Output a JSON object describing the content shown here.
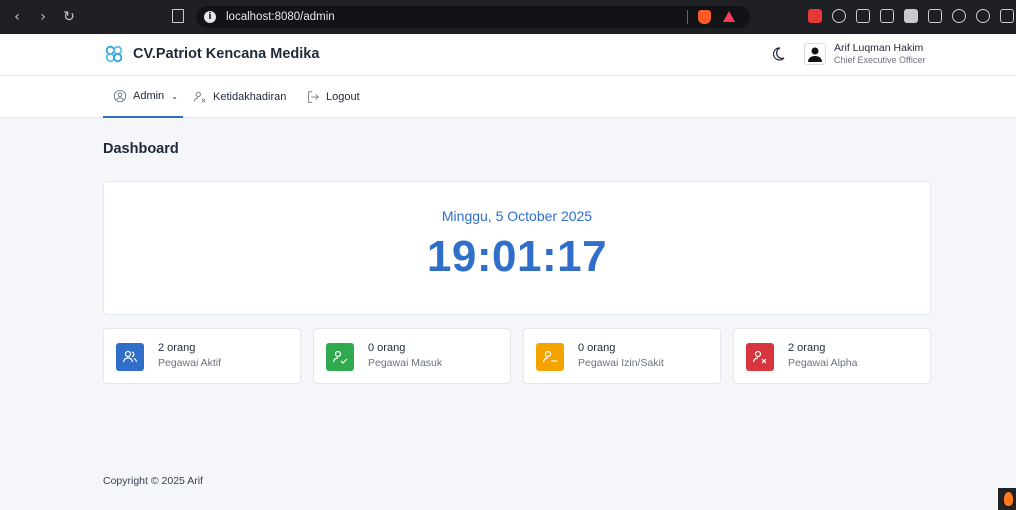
{
  "browser": {
    "url": "localhost:8080/admin",
    "nav": {
      "back": "‹",
      "forward": "›",
      "reload": "↻"
    }
  },
  "header": {
    "brand_name": "CV.Patriot Kencana Medika",
    "user_name": "Arif Luqman Hakim",
    "user_role": "Chief Executive Officer"
  },
  "menu": {
    "items": [
      {
        "label": "Admin",
        "icon": "user-circle-icon",
        "active": true,
        "dropdown": true
      },
      {
        "label": "Ketidakhadiran",
        "icon": "user-x-icon",
        "active": false
      },
      {
        "label": "Logout",
        "icon": "logout-icon",
        "active": false
      }
    ],
    "caret": "⌄"
  },
  "main": {
    "page_title": "Dashboard",
    "date": "Minggu, 5 October 2025",
    "time": "19:01:17",
    "stats": [
      {
        "count": "2 orang",
        "label": "Pegawai Aktif",
        "color": "#2f6fca",
        "icon": "users-icon"
      },
      {
        "count": "0 orang",
        "label": "Pegawai Masuk",
        "color": "#2faa4f",
        "icon": "user-check-icon"
      },
      {
        "count": "0 orang",
        "label": "Pegawai Izin/Sakit",
        "color": "#f5a300",
        "icon": "user-minus-icon"
      },
      {
        "count": "2 orang",
        "label": "Pegawai Alpha",
        "color": "#d8353f",
        "icon": "user-x-icon"
      }
    ]
  },
  "footer": {
    "copyright": "Copyright © 2025 Arif"
  },
  "colors": {
    "accent": "#2f6fca",
    "background": "#f4f6fa"
  }
}
